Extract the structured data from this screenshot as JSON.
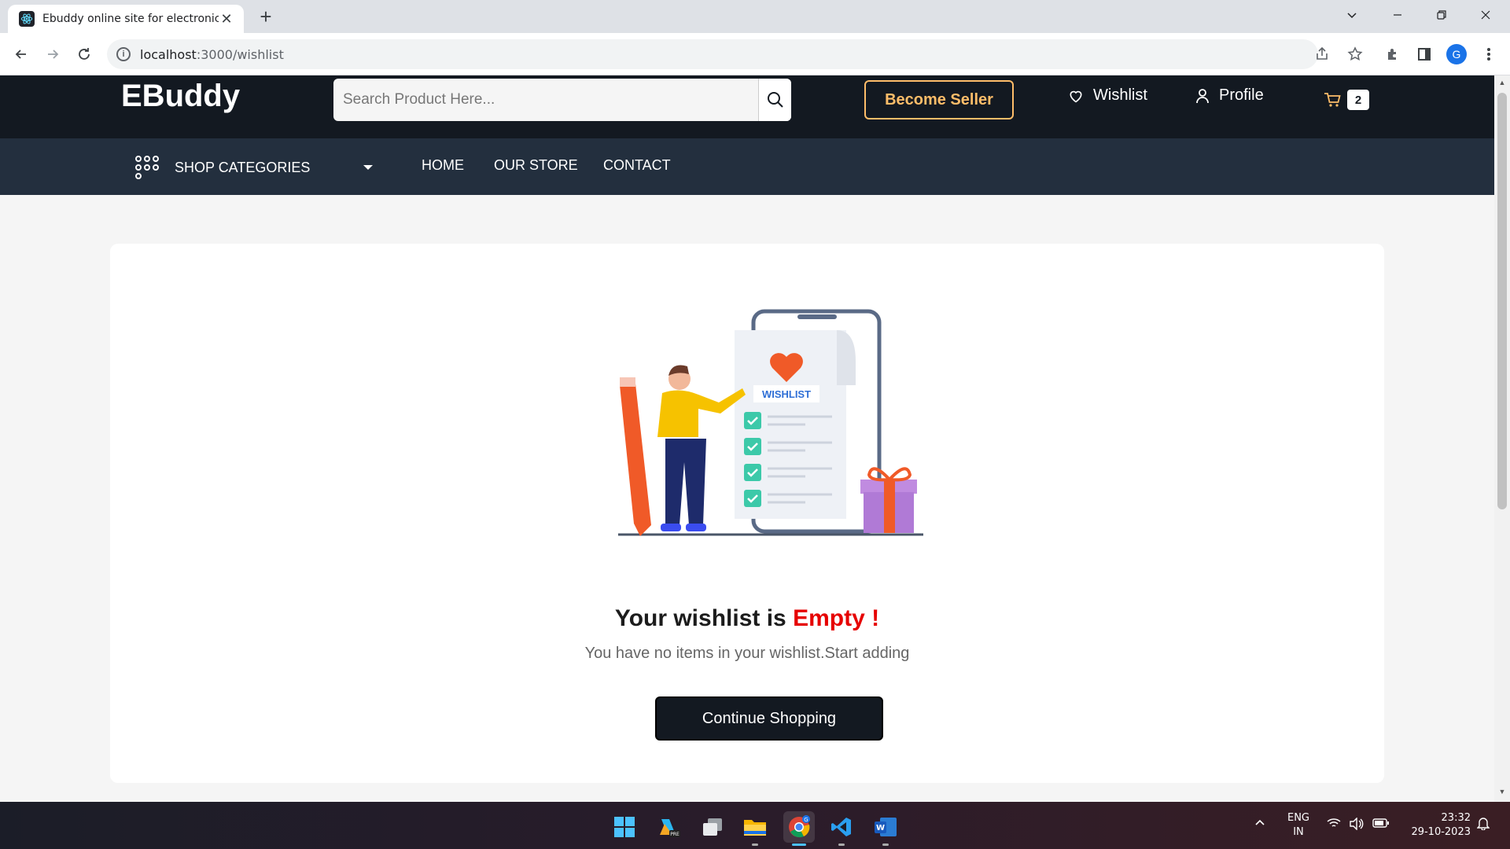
{
  "browser": {
    "tab_title": "Ebuddy online site for electronic",
    "tab_close": "✕",
    "new_tab": "+",
    "url_host": "localhost",
    "url_path": ":3000/wishlist"
  },
  "header": {
    "logo": "EBuddy",
    "search_placeholder": "Search Product Here...",
    "become_seller": "Become Seller",
    "wishlist": "Wishlist",
    "profile": "Profile",
    "cart_count": "2"
  },
  "nav": {
    "shop_categories": "SHOP CATEGORIES",
    "links": [
      "HOME",
      "OUR STORE",
      "CONTACT"
    ]
  },
  "main": {
    "illustration_label": "WISHLIST",
    "title_prefix": "Your wishlist is ",
    "title_highlight": "Empty !",
    "subtitle": "You have no items in your wishlist.Start adding",
    "continue_button": "Continue Shopping"
  },
  "taskbar": {
    "lang_top": "ENG",
    "lang_bottom": "IN",
    "time": "23:32",
    "date": "29-10-2023",
    "apps": [
      "windows-start-icon",
      "copilot-preview-icon",
      "task-view-icon",
      "file-explorer-icon",
      "chrome-icon",
      "vscode-icon",
      "word-icon"
    ]
  },
  "colors": {
    "header_dark": "#131921",
    "nav_dark": "#232f3e",
    "accent": "#febd69",
    "empty_red": "#e60000"
  }
}
